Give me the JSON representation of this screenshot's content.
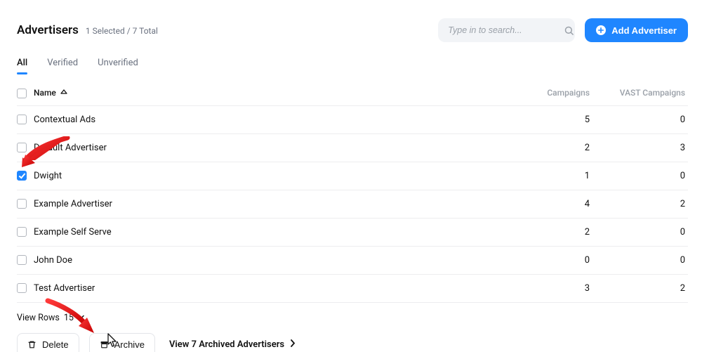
{
  "header": {
    "title": "Advertisers",
    "subtitle": "1 Selected / 7 Total",
    "search_placeholder": "Type in to search...",
    "add_button_label": "Add Advertiser"
  },
  "tabs": {
    "items": [
      {
        "label": "All",
        "active": true
      },
      {
        "label": "Verified",
        "active": false
      },
      {
        "label": "Unverified",
        "active": false
      }
    ]
  },
  "table": {
    "columns": {
      "name_label": "Name",
      "campaigns_label": "Campaigns",
      "vast_label": "VAST Campaigns"
    },
    "rows": [
      {
        "checked": false,
        "name": "Contextual Ads",
        "campaigns": "5",
        "vast": "0"
      },
      {
        "checked": false,
        "name": "Default Advertiser",
        "campaigns": "2",
        "vast": "3"
      },
      {
        "checked": true,
        "name": "Dwight",
        "campaigns": "1",
        "vast": "0"
      },
      {
        "checked": false,
        "name": "Example Advertiser",
        "campaigns": "4",
        "vast": "2"
      },
      {
        "checked": false,
        "name": "Example Self Serve",
        "campaigns": "2",
        "vast": "0"
      },
      {
        "checked": false,
        "name": "John Doe",
        "campaigns": "0",
        "vast": "0"
      },
      {
        "checked": false,
        "name": "Test Advertiser",
        "campaigns": "3",
        "vast": "2"
      }
    ]
  },
  "footer": {
    "view_rows_label": "View Rows",
    "view_rows_value": "15",
    "delete_label": "Delete",
    "archive_label": "Archive",
    "archived_link_label": "View 7 Archived Advertisers"
  },
  "annotations": {
    "arrow_color": "#e81c1c"
  }
}
